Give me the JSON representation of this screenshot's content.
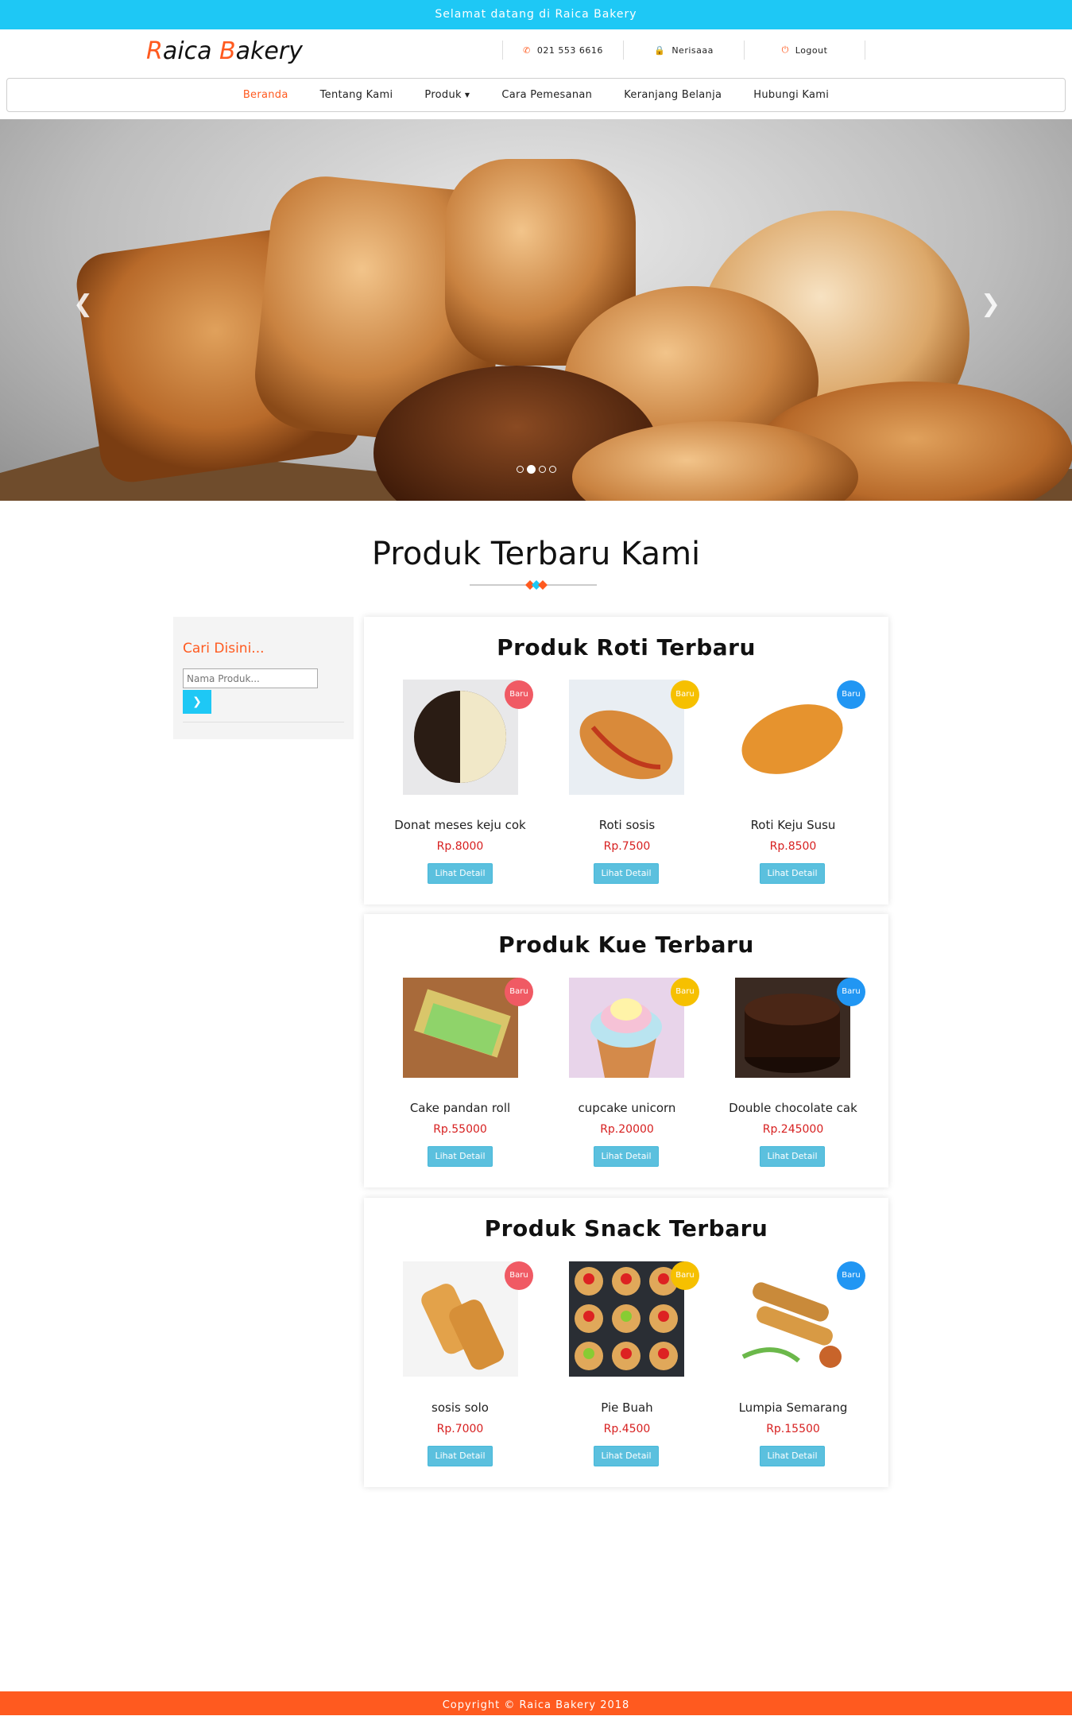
{
  "topbar": {
    "text": "Selamat datang di Raica Bakery"
  },
  "logo": {
    "r": "R",
    "aica": "aica ",
    "b": "B",
    "akery": "akery"
  },
  "header_links": [
    {
      "icon": "phone-icon",
      "label": "021 553 6616"
    },
    {
      "icon": "lock-icon",
      "label": "Nerisaaa"
    },
    {
      "icon": "power-icon",
      "label": "Logout"
    }
  ],
  "nav": [
    {
      "label": "Beranda",
      "active": true
    },
    {
      "label": "Tentang Kami"
    },
    {
      "label": "Produk",
      "dropdown": true
    },
    {
      "label": "Cara Pemesanan"
    },
    {
      "label": "Keranjang Belanja"
    },
    {
      "label": "Hubungi Kami"
    }
  ],
  "carousel": {
    "active_slide": 2,
    "slides": 4
  },
  "section_title": "Produk Terbaru Kami",
  "sidebar": {
    "title": "Cari Disini...",
    "placeholder": "Nama Produk...",
    "button_icon": "chevron-right-icon"
  },
  "badge_label": "Baru",
  "colors": {
    "accent": "#ff5a1f",
    "topbar": "#1ec8f5",
    "price": "#d72020",
    "button": "#5bc0de",
    "badge_red": "#f05a64",
    "badge_yellow": "#f6c000",
    "badge_blue": "#2196f3"
  },
  "cards": [
    {
      "title": "Produk Roti Terbaru",
      "products": [
        {
          "name": "Donat meses keju cok",
          "price": "Rp.8000",
          "button": "Lihat Detail"
        },
        {
          "name": "Roti sosis",
          "price": "Rp.7500",
          "button": "Lihat Detail"
        },
        {
          "name": "Roti Keju Susu",
          "price": "Rp.8500",
          "button": "Lihat Detail"
        }
      ]
    },
    {
      "title": "Produk Kue Terbaru",
      "products": [
        {
          "name": "Cake pandan roll",
          "price": "Rp.55000",
          "button": "Lihat Detail"
        },
        {
          "name": "cupcake unicorn",
          "price": "Rp.20000",
          "button": "Lihat Detail"
        },
        {
          "name": "Double chocolate cak",
          "price": "Rp.245000",
          "button": "Lihat Detail"
        }
      ]
    },
    {
      "title": "Produk Snack Terbaru",
      "products": [
        {
          "name": "sosis solo",
          "price": "Rp.7000",
          "button": "Lihat Detail"
        },
        {
          "name": "Pie Buah",
          "price": "Rp.4500",
          "button": "Lihat Detail"
        },
        {
          "name": "Lumpia Semarang",
          "price": "Rp.15500",
          "button": "Lihat Detail"
        }
      ]
    }
  ],
  "footer": {
    "text": "Copyright © Raica Bakery 2018"
  }
}
